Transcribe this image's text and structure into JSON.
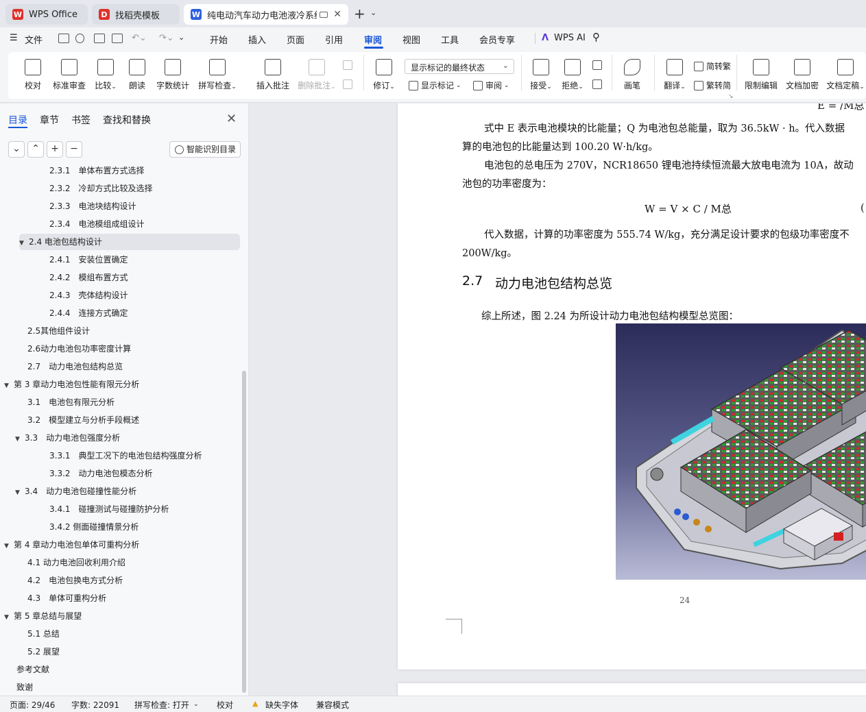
{
  "tabs": [
    {
      "label": "WPS Office",
      "active": false
    },
    {
      "label": "找稻壳模板",
      "active": false
    },
    {
      "label": "纯电动汽车动力电池液冷系统",
      "active": true
    }
  ],
  "menu": {
    "file": "文件",
    "items": [
      "开始",
      "插入",
      "页面",
      "引用",
      "审阅",
      "视图",
      "工具",
      "会员专享"
    ],
    "active": "审阅",
    "wps_ai": "WPS AI"
  },
  "ribbon": {
    "proofread": "校对",
    "standard_review": "标准审查",
    "compare": "比较",
    "read_aloud": "朗读",
    "word_count": "字数统计",
    "spell_check": "拼写检查",
    "insert_comment": "插入批注",
    "delete_comment": "删除批注",
    "track_changes": "修订",
    "markup_select": "显示标记的最终状态",
    "show_markup": "显示标记",
    "review": "审阅",
    "accept": "接受",
    "reject": "拒绝",
    "pen": "画笔",
    "translate": "翻译",
    "to_traditional": "简转繁",
    "to_simplified": "繁转简",
    "restrict_editing": "限制编辑",
    "doc_encrypt": "文档加密",
    "doc_finalize": "文档定稿"
  },
  "nav": {
    "tabs": [
      "目录",
      "章节",
      "书签",
      "查找和替换"
    ],
    "active_tab": "目录",
    "smart_toc": "智能识别目录",
    "toc": [
      {
        "text": "2.3.1　单体布置方式选择",
        "level": 3
      },
      {
        "text": "2.3.2　冷却方式比较及选择",
        "level": 3
      },
      {
        "text": "2.3.3　电池块结构设计",
        "level": 3
      },
      {
        "text": "2.3.4　电池模组成组设计",
        "level": 3
      },
      {
        "text": "2.4 电池包结构设计",
        "level": 2,
        "expanded": true,
        "selected": true
      },
      {
        "text": "2.4.1　安装位置确定",
        "level": 3
      },
      {
        "text": "2.4.2　模组布置方式",
        "level": 3
      },
      {
        "text": "2.4.3　壳体结构设计",
        "level": 3
      },
      {
        "text": "2.4.4　连接方式确定",
        "level": 3
      },
      {
        "text": "2.5其他组件设计",
        "level": 2
      },
      {
        "text": "2.6动力电池包功率密度计算",
        "level": 2
      },
      {
        "text": "2.7　动力电池包结构总览",
        "level": 2
      },
      {
        "text": "第 3 章动力电池包性能有限元分析",
        "level": 1,
        "expanded": true
      },
      {
        "text": "3.1　电池包有限元分析",
        "level": 2
      },
      {
        "text": "3.2　模型建立与分析手段概述",
        "level": 2
      },
      {
        "text": "3.3　动力电池包强度分析",
        "level": 2,
        "expanded": true
      },
      {
        "text": "3.3.1　典型工况下的电池包结构强度分析",
        "level": 3
      },
      {
        "text": "3.3.2　动力电池包模态分析",
        "level": 3
      },
      {
        "text": "3.4　动力电池包碰撞性能分析",
        "level": 2,
        "expanded": true
      },
      {
        "text": "3.4.1　碰撞测试与碰撞防护分析",
        "level": 3
      },
      {
        "text": "3.4.2 侧面碰撞情景分析",
        "level": 3
      },
      {
        "text": "第 4 章动力电池包单体可重构分析",
        "level": 1,
        "expanded": true
      },
      {
        "text": "4.1 动力电池回收利用介绍",
        "level": 2
      },
      {
        "text": "4.2　电池包换电方式分析",
        "level": 2
      },
      {
        "text": "4.3　单体可重构分析",
        "level": 2
      },
      {
        "text": "第 5 章总结与展望",
        "level": 1,
        "expanded": true
      },
      {
        "text": "5.1 总结",
        "level": 2
      },
      {
        "text": "5.2 展望",
        "level": 2
      },
      {
        "text": "参考文献",
        "level": 1
      },
      {
        "text": "致谢",
        "level": 1
      }
    ]
  },
  "doc": {
    "formula_top": "E = ∕M总",
    "p1_line1": "式中 E 表示电池模块的比能量；Q 为电池包总能量，取为 36.5kW · h。代入数据",
    "p1_line2": "算的电池包的比能量达到 100.20 W·h/kg。",
    "p2_line1": "电池包的总电压为 270V，NCR18650 锂电池持续恒流最大放电电流为 10A，故动",
    "p2_line2": "池包的功率密度为：",
    "formula": "W = V × C ∕ M总",
    "eq_no": "(",
    "p3_line1": "代入数据，计算的功率密度为 555.74 W/kg，充分满足设计要求的包级功率密度不",
    "p3_line2": "200W/kg。",
    "section_number": "2.7",
    "section_title": "动力电池包结构总览",
    "p4": "综上所述，图 2.24 为所设计动力电池包结构模型总览图：",
    "page_number": "24"
  },
  "status": {
    "page": "页面: 29/46",
    "words": "字数: 22091",
    "spell": "拼写检查: 打开",
    "proof": "校对",
    "missing_font": "缺失字体",
    "compat": "兼容模式"
  },
  "colors": {
    "accent": "#1a56d8",
    "wps_red": "#e0312d",
    "doc_blue": "#2f5fe0"
  }
}
